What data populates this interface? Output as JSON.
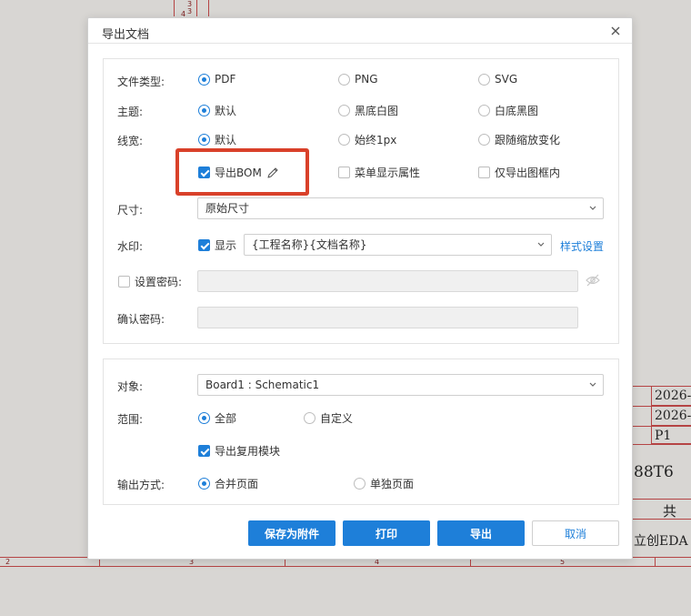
{
  "background": {
    "top_numbers": [
      "3",
      "3",
      "4"
    ],
    "title_block": {
      "cell1": "2026-",
      "cell2": "2026-",
      "cell3": "P1",
      "part_text": "88T6",
      "total_label": "共",
      "company": "立创EDA"
    },
    "ruler": [
      "2",
      "3",
      "4",
      "5"
    ]
  },
  "dialog": {
    "title": "导出文档",
    "file_type": {
      "label": "文件类型:",
      "options": [
        "PDF",
        "PNG",
        "SVG"
      ],
      "selected": "PDF"
    },
    "theme": {
      "label": "主题:",
      "options": [
        "默认",
        "黑底白图",
        "白底黑图"
      ],
      "selected": "默认"
    },
    "line_width": {
      "label": "线宽:",
      "options": [
        "默认",
        "始终1px",
        "跟随缩放变化"
      ],
      "selected": "默认"
    },
    "extra_checks": [
      {
        "label": "导出BOM",
        "checked": true
      },
      {
        "label": "菜单显示属性",
        "checked": false
      },
      {
        "label": "仅导出图框内",
        "checked": false
      }
    ],
    "size": {
      "label": "尺寸:",
      "value": "原始尺寸"
    },
    "watermark": {
      "label": "水印:",
      "show_label": "显示",
      "show_checked": true,
      "value": "{工程名称}{文档名称}",
      "style_link": "样式设置"
    },
    "password": {
      "label": "设置密码:",
      "checked": false
    },
    "confirm_password": {
      "label": "确认密码:"
    },
    "object": {
      "label": "对象:",
      "value": "Board1 : Schematic1"
    },
    "range": {
      "label": "范围:",
      "options": [
        "全部",
        "自定义"
      ],
      "selected": "全部"
    },
    "export_reuse": {
      "label": "导出复用模块",
      "checked": true
    },
    "output_mode": {
      "label": "输出方式:",
      "options": [
        "合并页面",
        "单独页面"
      ],
      "selected": "合并页面"
    },
    "buttons": {
      "save_attachment": "保存为附件",
      "print": "打印",
      "export": "导出",
      "cancel": "取消"
    }
  },
  "colors": {
    "accent": "#1e7fd9",
    "highlight": "#d9412a",
    "schematic_line": "#b54444"
  }
}
